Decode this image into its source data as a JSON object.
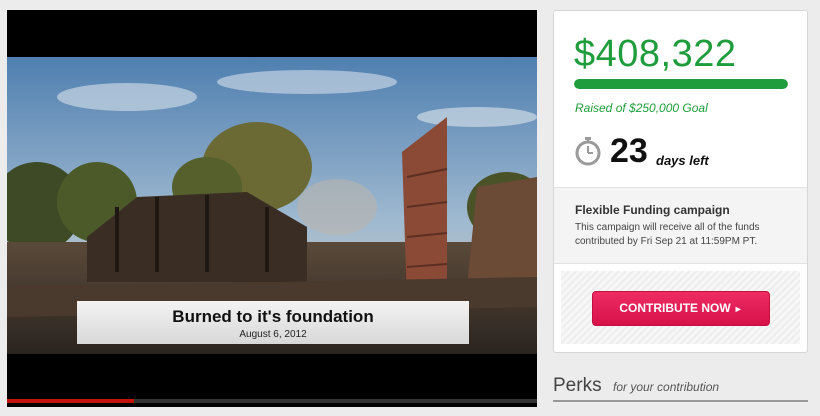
{
  "video": {
    "caption_title": "Burned to it's foundation",
    "caption_date": "August 6, 2012",
    "progress": 0.24,
    "progress_color": "#c4120c"
  },
  "campaign": {
    "raised": "$408,322",
    "goal_text": "Raised of $250,000 Goal",
    "goal_progress": 1.0,
    "accent_color": "#1f9d3c",
    "timer_icon": "stopwatch-icon",
    "days_number": "23",
    "days_label": "days left",
    "funding_title": "Flexible Funding campaign",
    "funding_desc": "This campaign will receive all of the funds contributed by Fri Sep 21 at 11:59PM PT.",
    "cta_label": "CONTRIBUTE NOW",
    "cta_arrow": "►",
    "cta_color": "#e51d57"
  },
  "perks": {
    "title": "Perks",
    "subtitle": "for your contribution"
  }
}
